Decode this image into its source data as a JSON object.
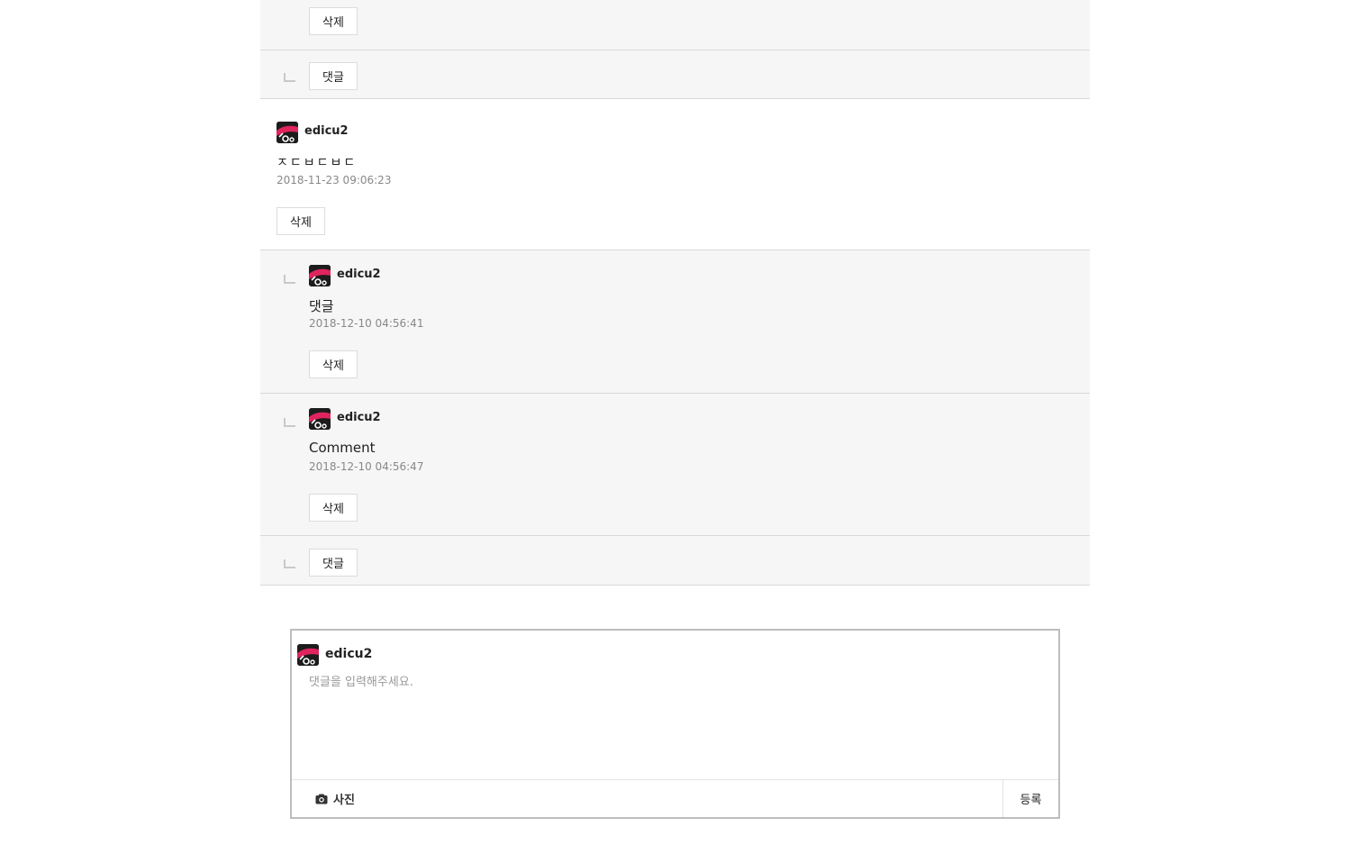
{
  "top_reply": {
    "delete_label": "삭제"
  },
  "reply_bar_1": {
    "reply_label": "댓글"
  },
  "comment": {
    "username": "edicu2",
    "text": "ㅈㄷㅂㄷㅂㄷ",
    "date": "2018-11-23 09:06:23",
    "delete_label": "삭제"
  },
  "replies": [
    {
      "username": "edicu2",
      "text": "댓글",
      "date": "2018-12-10 04:56:41",
      "delete_label": "삭제"
    },
    {
      "username": "edicu2",
      "text": "Comment",
      "date": "2018-12-10 04:56:47",
      "delete_label": "삭제"
    }
  ],
  "reply_bar_2": {
    "reply_label": "댓글"
  },
  "composer": {
    "username": "edicu2",
    "placeholder": "댓글을 입력해주세요.",
    "photo_label": "사진",
    "submit_label": "등록"
  },
  "colors": {
    "gray_bg": "#f6f6f6",
    "border": "#d8d8d8",
    "avatar_accent": "#e0245e"
  }
}
